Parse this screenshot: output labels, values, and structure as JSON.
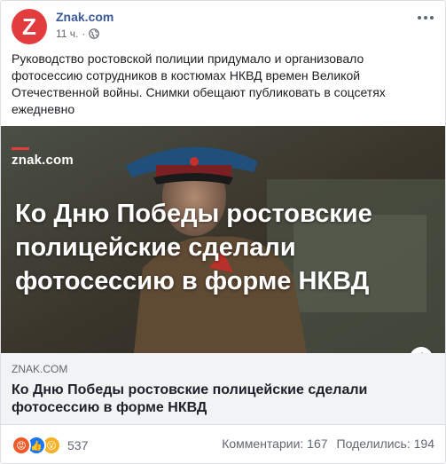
{
  "post": {
    "page_name": "Znak.com",
    "avatar_letter": "Z",
    "time": "11 ч.",
    "dot": "·",
    "text": "Руководство ростовской полиции придумало и организовало фотосессию сотрудников в костюмах НКВД времен Великой Отечественной войны. Снимки обещают публиковать в соцсетях ежедневно"
  },
  "link": {
    "image_brand": "znak.com",
    "image_headline": "Ко Дню Победы ростовские полицейские сделали фотосессию в форме НКВД",
    "domain": "ZNAK.COM",
    "title": "Ко Дню Победы ростовские полицейские сделали фотосессию в форме НКВД",
    "info_icon": "i"
  },
  "footer": {
    "reaction_count": "537",
    "comments": "Комментарии: 167",
    "shares": "Поделились: 194"
  },
  "icons": {
    "reactions": [
      "angry-reaction-icon",
      "like-reaction-icon",
      "wow-reaction-icon"
    ],
    "privacy": "globe-icon",
    "more": "more-options-icon"
  },
  "colors": {
    "brand_red": "#e23c3f",
    "link_blue": "#385898",
    "muted": "#606770"
  }
}
